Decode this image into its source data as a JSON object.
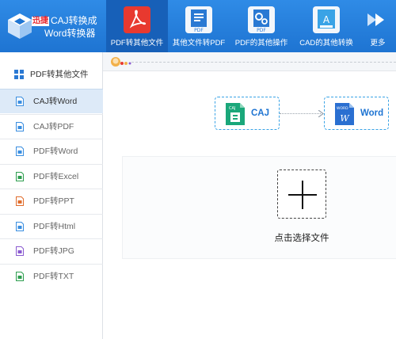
{
  "app": {
    "brand": "迅捷",
    "title_line1": "CAJ转换成",
    "title_line2": "Word转换器"
  },
  "nav": [
    {
      "label": "PDF转其他文件",
      "icon": "pdf-acrobat-icon",
      "active": true
    },
    {
      "label": "其他文件转PDF",
      "icon": "document-to-pdf-icon"
    },
    {
      "label": "PDF的其他操作",
      "icon": "pdf-gear-icon"
    },
    {
      "label": "CAD的其他转换",
      "icon": "cad-convert-icon"
    },
    {
      "label": "更多",
      "icon": "double-chevron-right-icon"
    }
  ],
  "sidebar": {
    "header": "PDF转其他文件",
    "items": [
      {
        "label": "CAJ转Word",
        "selected": true,
        "color": "#3a8ee0"
      },
      {
        "label": "CAJ转PDF",
        "color": "#3a8ee0"
      },
      {
        "label": "PDF转Word",
        "color": "#3a8ee0"
      },
      {
        "label": "PDF转Excel",
        "color": "#2e9e4f"
      },
      {
        "label": "PDF转PPT",
        "color": "#e06c2c"
      },
      {
        "label": "PDF转Html",
        "color": "#3a8ee0"
      },
      {
        "label": "PDF转JPG",
        "color": "#8a5ad0"
      },
      {
        "label": "PDF转TXT",
        "color": "#2e9e4f"
      }
    ]
  },
  "conversion": {
    "from_label": "CAJ",
    "from_icon_text": "CAJ",
    "to_label": "Word",
    "to_icon_text": "WORD",
    "to_icon_letter": "W"
  },
  "dropzone": {
    "label": "点击选择文件"
  },
  "colors": {
    "topbar": "#2379d8",
    "accent": "#1e74d2",
    "caj_green": "#1aa77a",
    "word_blue": "#2a6fd1",
    "selected_row": "#ddeaf8"
  }
}
